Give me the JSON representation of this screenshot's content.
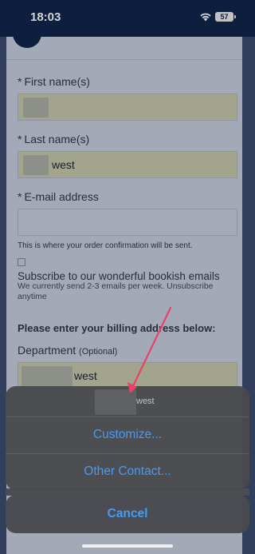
{
  "status_bar": {
    "time": "18:03",
    "battery": "57"
  },
  "form": {
    "first_name_label": "First name(s)",
    "last_name_label": "Last name(s)",
    "last_name_value": "west",
    "email_label": "E-mail address",
    "email_helper": "This is where your order confirmation will be sent.",
    "subscribe_title": "Subscribe to our wonderful bookish emails",
    "subscribe_note": "We currently send 2-3 emails per week. Unsubscribe anytime",
    "billing_heading": "Please enter your billing address below:",
    "department_label": "Department",
    "department_optional": "(Optional)",
    "department_value": "west",
    "required_marker": "*"
  },
  "action_sheet": {
    "header_text": "west",
    "customize_label": "Customize...",
    "other_contact_label": "Other Contact...",
    "cancel_label": "Cancel"
  },
  "colors": {
    "nav_bar": "#0f2147",
    "autofill_yellow": "#f3f4b8",
    "action_blue": "#4a9af2",
    "annotation_arrow": "#e8426a"
  }
}
